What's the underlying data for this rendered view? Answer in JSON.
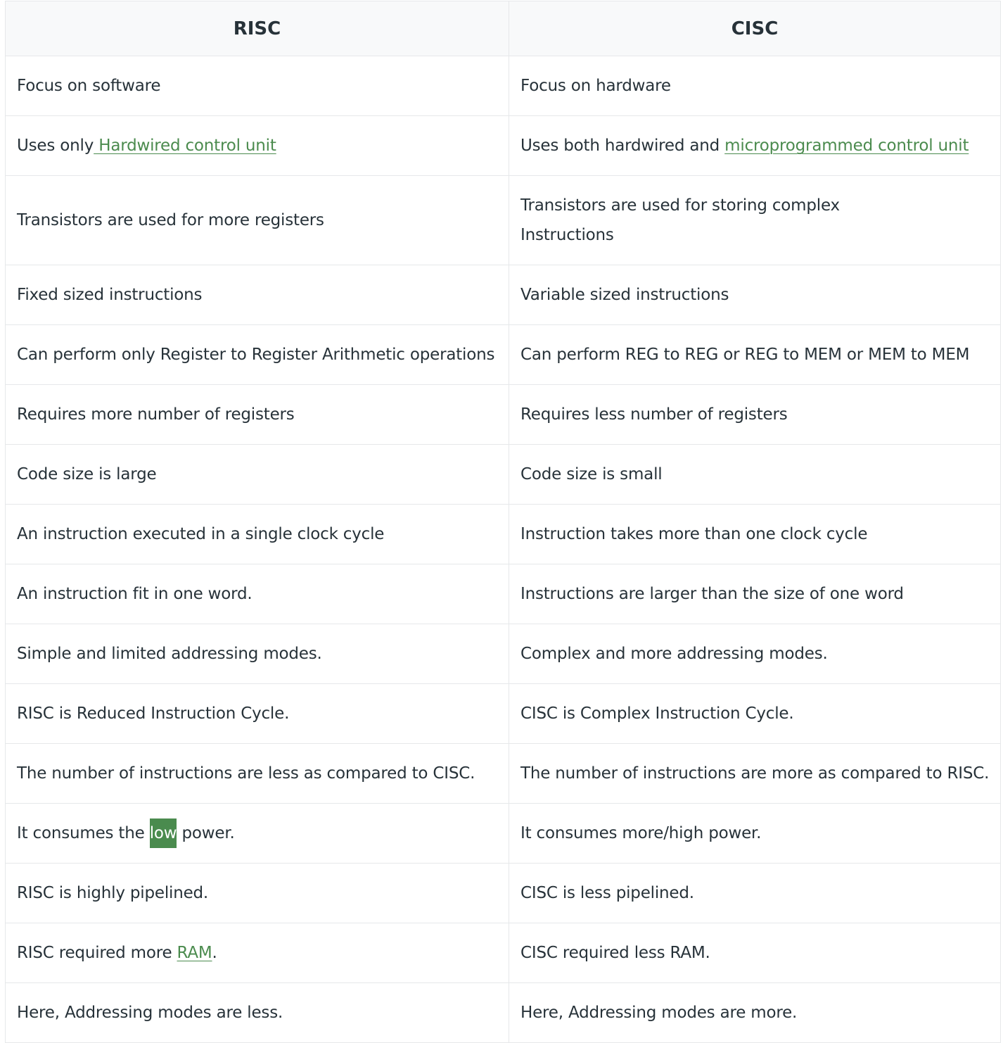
{
  "table": {
    "headers": [
      "RISC",
      "CISC"
    ],
    "rows": [
      {
        "risc": "Focus on software",
        "cisc": "Focus on hardware"
      },
      {
        "risc_prefix": "Uses only",
        "risc_link": " Hardwired control unit",
        "cisc_prefix": "Uses both hardwired and ",
        "cisc_link": "microprogrammed control unit"
      },
      {
        "risc": "Transistors are used for more registers",
        "cisc": "Transistors are used for storing complex Instructions"
      },
      {
        "risc": "Fixed sized instructions",
        "cisc": "Variable sized instructions"
      },
      {
        "risc": "Can perform only Register to Register Arithmetic operations",
        "cisc": "Can perform REG to REG or REG to MEM or MEM to MEM"
      },
      {
        "risc": "Requires more number of registers",
        "cisc": "Requires less number of registers"
      },
      {
        "risc": "Code size is large",
        "cisc": "Code size is small"
      },
      {
        "risc": "An instruction executed in a single clock cycle",
        "cisc": "Instruction takes more than one clock cycle"
      },
      {
        "risc": "An instruction fit in one word.",
        "cisc": "Instructions are larger than the size of one word"
      },
      {
        "risc": "Simple and limited addressing modes.",
        "cisc": "Complex and more addressing modes."
      },
      {
        "risc": "RISC is Reduced Instruction Cycle.",
        "cisc": "CISC is Complex Instruction Cycle."
      },
      {
        "risc": "The number of instructions are less as compared to CISC.",
        "cisc": "The number of instructions are more as compared to RISC."
      },
      {
        "risc_prefix": "It consumes the ",
        "risc_highlight": "low",
        "risc_suffix": " power.",
        "cisc": "It consumes more/high power."
      },
      {
        "risc": "RISC is highly pipelined.",
        "cisc": "CISC is less pipelined."
      },
      {
        "risc_prefix": "RISC required more ",
        "risc_link": "RAM",
        "risc_suffix": ".",
        "cisc": "CISC required less RAM."
      },
      {
        "risc": "Here, Addressing modes are less.",
        "cisc": "Here, Addressing modes are more."
      }
    ]
  },
  "colors": {
    "link": "#4b8b4e",
    "highlight_bg": "#4a8b4e",
    "text": "#273239",
    "header_bg": "#f8f9fa",
    "border": "#e6e8ea"
  }
}
